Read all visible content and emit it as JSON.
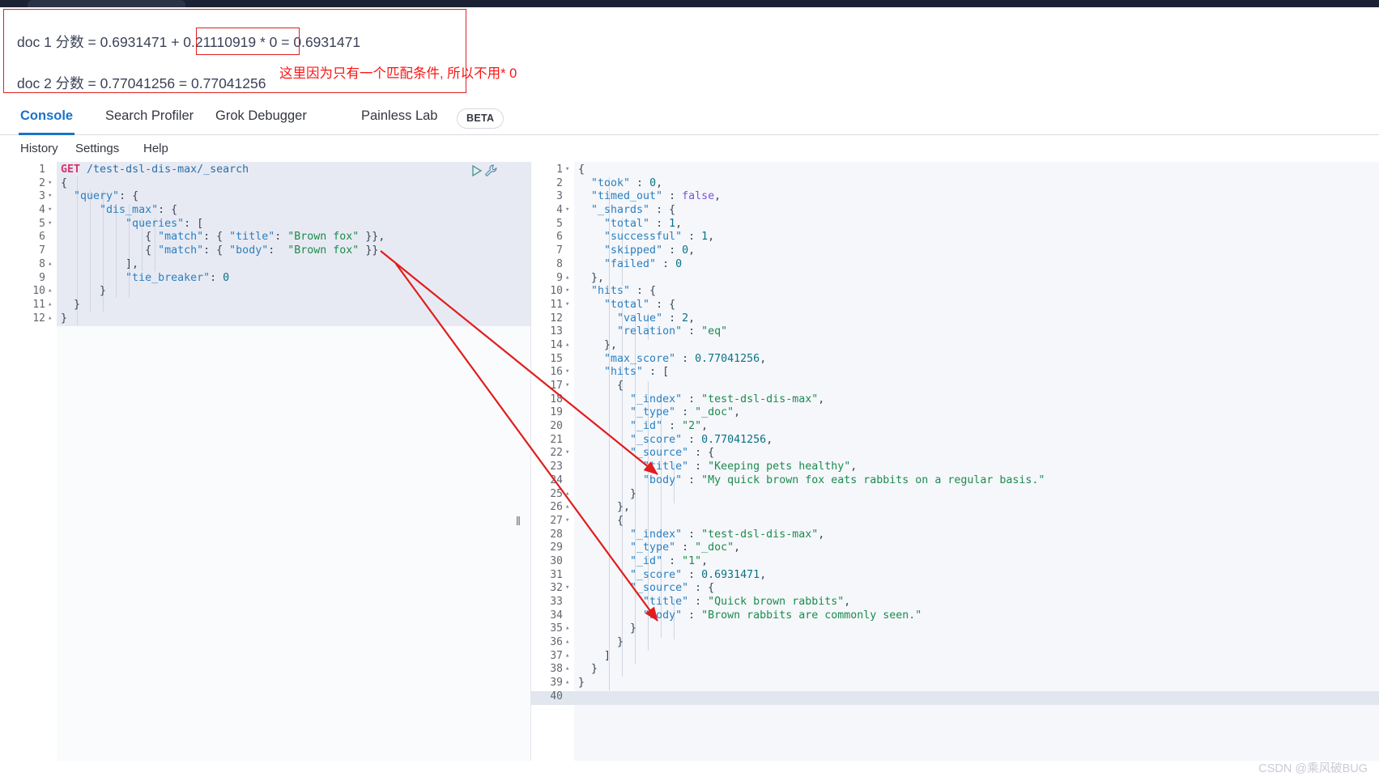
{
  "annotation": {
    "line1": "doc 1 分数 = 0.6931471 + 0.21110919 * 0 = 0.6931471",
    "line2": "doc 2 分数 = 0.77041256 = 0.77041256",
    "note_red": "这里因为只有一个匹配条件, 所以不用* 0",
    "box_color": "#e02020",
    "note_color": "#fb1414"
  },
  "tabs": [
    {
      "label": "Console",
      "active": true
    },
    {
      "label": "Search Profiler",
      "active": false
    },
    {
      "label": "Grok Debugger",
      "active": false
    },
    {
      "label": "Painless Lab",
      "active": false
    }
  ],
  "beta_badge": "BETA",
  "submenu": [
    {
      "label": "History"
    },
    {
      "label": "Settings"
    },
    {
      "label": "Help"
    }
  ],
  "accent_color": "#1a73c9",
  "request_editor": {
    "lines": [
      {
        "n": "1",
        "fold": "",
        "tokens": [
          {
            "t": "GET ",
            "c": "tok-method"
          },
          {
            "t": "/test-dsl-dis-max/_search",
            "c": "tok-url"
          }
        ]
      },
      {
        "n": "2",
        "fold": "▾",
        "tokens": [
          {
            "t": "{",
            "c": "tok-punct"
          }
        ]
      },
      {
        "n": "3",
        "fold": "▾",
        "tokens": [
          {
            "t": "  \"query\"",
            "c": "tok-key"
          },
          {
            "t": ": {",
            "c": "tok-punct"
          }
        ]
      },
      {
        "n": "4",
        "fold": "▾",
        "tokens": [
          {
            "t": "      \"dis_max\"",
            "c": "tok-key"
          },
          {
            "t": ": {",
            "c": "tok-punct"
          }
        ]
      },
      {
        "n": "5",
        "fold": "▾",
        "tokens": [
          {
            "t": "          \"queries\"",
            "c": "tok-key"
          },
          {
            "t": ": [",
            "c": "tok-punct"
          }
        ]
      },
      {
        "n": "6",
        "fold": "",
        "tokens": [
          {
            "t": "             { ",
            "c": "tok-punct"
          },
          {
            "t": "\"match\"",
            "c": "tok-key"
          },
          {
            "t": ": { ",
            "c": "tok-punct"
          },
          {
            "t": "\"title\"",
            "c": "tok-key"
          },
          {
            "t": ": ",
            "c": "tok-punct"
          },
          {
            "t": "\"Brown fox\"",
            "c": "tok-str"
          },
          {
            "t": " }},",
            "c": "tok-punct"
          }
        ]
      },
      {
        "n": "7",
        "fold": "",
        "tokens": [
          {
            "t": "             { ",
            "c": "tok-punct"
          },
          {
            "t": "\"match\"",
            "c": "tok-key"
          },
          {
            "t": ": { ",
            "c": "tok-punct"
          },
          {
            "t": "\"body\"",
            "c": "tok-key"
          },
          {
            "t": ":  ",
            "c": "tok-punct"
          },
          {
            "t": "\"Brown fox\"",
            "c": "tok-str"
          },
          {
            "t": " }}",
            "c": "tok-punct"
          }
        ]
      },
      {
        "n": "8",
        "fold": "▴",
        "tokens": [
          {
            "t": "          ],",
            "c": "tok-punct"
          }
        ]
      },
      {
        "n": "9",
        "fold": "",
        "tokens": [
          {
            "t": "          \"tie_breaker\"",
            "c": "tok-key"
          },
          {
            "t": ": ",
            "c": "tok-punct"
          },
          {
            "t": "0",
            "c": "tok-num"
          }
        ]
      },
      {
        "n": "10",
        "fold": "▴",
        "tokens": [
          {
            "t": "      }",
            "c": "tok-punct"
          }
        ]
      },
      {
        "n": "11",
        "fold": "▴",
        "tokens": [
          {
            "t": "  }",
            "c": "tok-punct"
          }
        ]
      },
      {
        "n": "12",
        "fold": "▴",
        "tokens": [
          {
            "t": "}",
            "c": "tok-punct"
          }
        ]
      }
    ]
  },
  "response_editor": {
    "lines": [
      {
        "n": "1",
        "fold": "▾",
        "tokens": [
          {
            "t": "{",
            "c": "tok-punct"
          }
        ]
      },
      {
        "n": "2",
        "fold": "",
        "tokens": [
          {
            "t": "  \"took\"",
            "c": "tok-key"
          },
          {
            "t": " : ",
            "c": "tok-punct"
          },
          {
            "t": "0",
            "c": "tok-num"
          },
          {
            "t": ",",
            "c": "tok-punct"
          }
        ]
      },
      {
        "n": "3",
        "fold": "",
        "tokens": [
          {
            "t": "  \"timed_out\"",
            "c": "tok-key"
          },
          {
            "t": " : ",
            "c": "tok-punct"
          },
          {
            "t": "false",
            "c": "tok-bool"
          },
          {
            "t": ",",
            "c": "tok-punct"
          }
        ]
      },
      {
        "n": "4",
        "fold": "▾",
        "tokens": [
          {
            "t": "  \"_shards\"",
            "c": "tok-key"
          },
          {
            "t": " : {",
            "c": "tok-punct"
          }
        ]
      },
      {
        "n": "5",
        "fold": "",
        "tokens": [
          {
            "t": "    \"total\"",
            "c": "tok-key"
          },
          {
            "t": " : ",
            "c": "tok-punct"
          },
          {
            "t": "1",
            "c": "tok-num"
          },
          {
            "t": ",",
            "c": "tok-punct"
          }
        ]
      },
      {
        "n": "6",
        "fold": "",
        "tokens": [
          {
            "t": "    \"successful\"",
            "c": "tok-key"
          },
          {
            "t": " : ",
            "c": "tok-punct"
          },
          {
            "t": "1",
            "c": "tok-num"
          },
          {
            "t": ",",
            "c": "tok-punct"
          }
        ]
      },
      {
        "n": "7",
        "fold": "",
        "tokens": [
          {
            "t": "    \"skipped\"",
            "c": "tok-key"
          },
          {
            "t": " : ",
            "c": "tok-punct"
          },
          {
            "t": "0",
            "c": "tok-num"
          },
          {
            "t": ",",
            "c": "tok-punct"
          }
        ]
      },
      {
        "n": "8",
        "fold": "",
        "tokens": [
          {
            "t": "    \"failed\"",
            "c": "tok-key"
          },
          {
            "t": " : ",
            "c": "tok-punct"
          },
          {
            "t": "0",
            "c": "tok-num"
          }
        ]
      },
      {
        "n": "9",
        "fold": "▴",
        "tokens": [
          {
            "t": "  },",
            "c": "tok-punct"
          }
        ]
      },
      {
        "n": "10",
        "fold": "▾",
        "tokens": [
          {
            "t": "  \"hits\"",
            "c": "tok-key"
          },
          {
            "t": " : {",
            "c": "tok-punct"
          }
        ]
      },
      {
        "n": "11",
        "fold": "▾",
        "tokens": [
          {
            "t": "    \"total\"",
            "c": "tok-key"
          },
          {
            "t": " : {",
            "c": "tok-punct"
          }
        ]
      },
      {
        "n": "12",
        "fold": "",
        "tokens": [
          {
            "t": "      \"value\"",
            "c": "tok-key"
          },
          {
            "t": " : ",
            "c": "tok-punct"
          },
          {
            "t": "2",
            "c": "tok-num"
          },
          {
            "t": ",",
            "c": "tok-punct"
          }
        ]
      },
      {
        "n": "13",
        "fold": "",
        "tokens": [
          {
            "t": "      \"relation\"",
            "c": "tok-key"
          },
          {
            "t": " : ",
            "c": "tok-punct"
          },
          {
            "t": "\"eq\"",
            "c": "tok-str"
          }
        ]
      },
      {
        "n": "14",
        "fold": "▴",
        "tokens": [
          {
            "t": "    },",
            "c": "tok-punct"
          }
        ]
      },
      {
        "n": "15",
        "fold": "",
        "tokens": [
          {
            "t": "    \"max_score\"",
            "c": "tok-key"
          },
          {
            "t": " : ",
            "c": "tok-punct"
          },
          {
            "t": "0.77041256",
            "c": "tok-num"
          },
          {
            "t": ",",
            "c": "tok-punct"
          }
        ]
      },
      {
        "n": "16",
        "fold": "▾",
        "tokens": [
          {
            "t": "    \"hits\"",
            "c": "tok-key"
          },
          {
            "t": " : [",
            "c": "tok-punct"
          }
        ]
      },
      {
        "n": "17",
        "fold": "▾",
        "tokens": [
          {
            "t": "      {",
            "c": "tok-punct"
          }
        ]
      },
      {
        "n": "18",
        "fold": "",
        "tokens": [
          {
            "t": "        \"_index\"",
            "c": "tok-key"
          },
          {
            "t": " : ",
            "c": "tok-punct"
          },
          {
            "t": "\"test-dsl-dis-max\"",
            "c": "tok-str"
          },
          {
            "t": ",",
            "c": "tok-punct"
          }
        ]
      },
      {
        "n": "19",
        "fold": "",
        "tokens": [
          {
            "t": "        \"_type\"",
            "c": "tok-key"
          },
          {
            "t": " : ",
            "c": "tok-punct"
          },
          {
            "t": "\"_doc\"",
            "c": "tok-str"
          },
          {
            "t": ",",
            "c": "tok-punct"
          }
        ]
      },
      {
        "n": "20",
        "fold": "",
        "tokens": [
          {
            "t": "        \"_id\"",
            "c": "tok-key"
          },
          {
            "t": " : ",
            "c": "tok-punct"
          },
          {
            "t": "\"2\"",
            "c": "tok-str"
          },
          {
            "t": ",",
            "c": "tok-punct"
          }
        ]
      },
      {
        "n": "21",
        "fold": "",
        "tokens": [
          {
            "t": "        \"_score\"",
            "c": "tok-key"
          },
          {
            "t": " : ",
            "c": "tok-punct"
          },
          {
            "t": "0.77041256",
            "c": "tok-num"
          },
          {
            "t": ",",
            "c": "tok-punct"
          }
        ]
      },
      {
        "n": "22",
        "fold": "▾",
        "tokens": [
          {
            "t": "        \"_source\"",
            "c": "tok-key"
          },
          {
            "t": " : {",
            "c": "tok-punct"
          }
        ]
      },
      {
        "n": "23",
        "fold": "",
        "tokens": [
          {
            "t": "          \"title\"",
            "c": "tok-key"
          },
          {
            "t": " : ",
            "c": "tok-punct"
          },
          {
            "t": "\"Keeping pets healthy\"",
            "c": "tok-str"
          },
          {
            "t": ",",
            "c": "tok-punct"
          }
        ]
      },
      {
        "n": "24",
        "fold": "",
        "tokens": [
          {
            "t": "          \"body\"",
            "c": "tok-key"
          },
          {
            "t": " : ",
            "c": "tok-punct"
          },
          {
            "t": "\"My quick brown fox eats rabbits on a regular basis.\"",
            "c": "tok-str"
          }
        ]
      },
      {
        "n": "25",
        "fold": "▴",
        "tokens": [
          {
            "t": "        }",
            "c": "tok-punct"
          }
        ]
      },
      {
        "n": "26",
        "fold": "▴",
        "tokens": [
          {
            "t": "      },",
            "c": "tok-punct"
          }
        ]
      },
      {
        "n": "27",
        "fold": "▾",
        "tokens": [
          {
            "t": "      {",
            "c": "tok-punct"
          }
        ]
      },
      {
        "n": "28",
        "fold": "",
        "tokens": [
          {
            "t": "        \"_index\"",
            "c": "tok-key"
          },
          {
            "t": " : ",
            "c": "tok-punct"
          },
          {
            "t": "\"test-dsl-dis-max\"",
            "c": "tok-str"
          },
          {
            "t": ",",
            "c": "tok-punct"
          }
        ]
      },
      {
        "n": "29",
        "fold": "",
        "tokens": [
          {
            "t": "        \"_type\"",
            "c": "tok-key"
          },
          {
            "t": " : ",
            "c": "tok-punct"
          },
          {
            "t": "\"_doc\"",
            "c": "tok-str"
          },
          {
            "t": ",",
            "c": "tok-punct"
          }
        ]
      },
      {
        "n": "30",
        "fold": "",
        "tokens": [
          {
            "t": "        \"_id\"",
            "c": "tok-key"
          },
          {
            "t": " : ",
            "c": "tok-punct"
          },
          {
            "t": "\"1\"",
            "c": "tok-str"
          },
          {
            "t": ",",
            "c": "tok-punct"
          }
        ]
      },
      {
        "n": "31",
        "fold": "",
        "tokens": [
          {
            "t": "        \"_score\"",
            "c": "tok-key"
          },
          {
            "t": " : ",
            "c": "tok-punct"
          },
          {
            "t": "0.6931471",
            "c": "tok-num"
          },
          {
            "t": ",",
            "c": "tok-punct"
          }
        ]
      },
      {
        "n": "32",
        "fold": "▾",
        "tokens": [
          {
            "t": "        \"_source\"",
            "c": "tok-key"
          },
          {
            "t": " : {",
            "c": "tok-punct"
          }
        ]
      },
      {
        "n": "33",
        "fold": "",
        "tokens": [
          {
            "t": "          \"title\"",
            "c": "tok-key"
          },
          {
            "t": " : ",
            "c": "tok-punct"
          },
          {
            "t": "\"Quick brown rabbits\"",
            "c": "tok-str"
          },
          {
            "t": ",",
            "c": "tok-punct"
          }
        ]
      },
      {
        "n": "34",
        "fold": "",
        "tokens": [
          {
            "t": "          \"body\"",
            "c": "tok-key"
          },
          {
            "t": " : ",
            "c": "tok-punct"
          },
          {
            "t": "\"Brown rabbits are commonly seen.\"",
            "c": "tok-str"
          }
        ]
      },
      {
        "n": "35",
        "fold": "▴",
        "tokens": [
          {
            "t": "        }",
            "c": "tok-punct"
          }
        ]
      },
      {
        "n": "36",
        "fold": "▴",
        "tokens": [
          {
            "t": "      }",
            "c": "tok-punct"
          }
        ]
      },
      {
        "n": "37",
        "fold": "▴",
        "tokens": [
          {
            "t": "    ]",
            "c": "tok-punct"
          }
        ]
      },
      {
        "n": "38",
        "fold": "▴",
        "tokens": [
          {
            "t": "  }",
            "c": "tok-punct"
          }
        ]
      },
      {
        "n": "39",
        "fold": "▴",
        "tokens": [
          {
            "t": "}",
            "c": "tok-punct"
          }
        ]
      },
      {
        "n": "40",
        "fold": "",
        "tokens": [
          {
            "t": "",
            "c": "tok-punct"
          }
        ]
      }
    ]
  },
  "watermark": "CSDN @乘风破BUG"
}
